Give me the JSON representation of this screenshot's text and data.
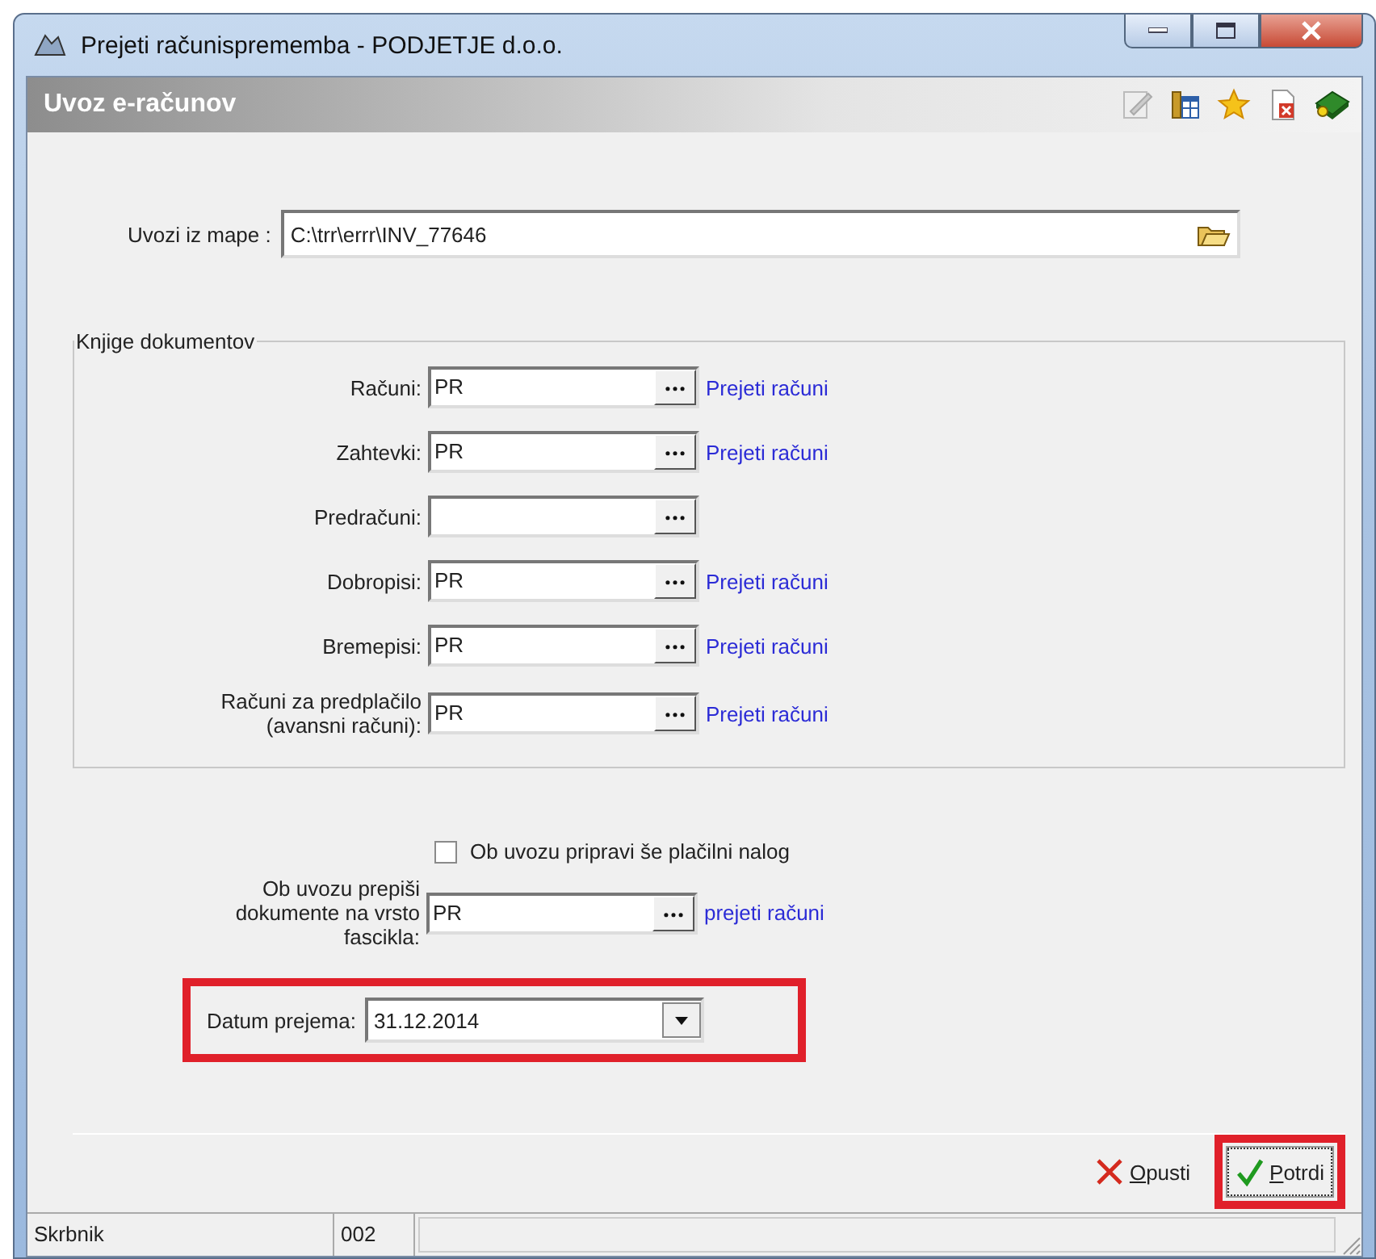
{
  "window": {
    "title": "Prejeti računisprememba - PODJETJE d.o.o."
  },
  "header": {
    "title": "Uvoz e-računov"
  },
  "import_folder": {
    "label": "Uvozi iz mape :",
    "value": "C:\\trr\\errr\\INV_77646"
  },
  "books": {
    "legend": "Knjige dokumentov",
    "rows": [
      {
        "label": "Računi:",
        "value": "PR",
        "description": "Prejeti računi"
      },
      {
        "label": "Zahtevki:",
        "value": "PR",
        "description": "Prejeti računi"
      },
      {
        "label": "Predračuni:"
      },
      {
        "label": "Dobropisi:",
        "value": "PR",
        "description": "Prejeti računi"
      },
      {
        "label": "Bremepisi:",
        "value": "PR",
        "description": "Prejeti računi"
      },
      {
        "label": "Računi za predplačilo\n(avansni računi):",
        "value": "PR",
        "description": "Prejeti računi"
      }
    ]
  },
  "payment_order": {
    "label": "Ob uvozu pripravi še plačilni nalog",
    "checked": false
  },
  "folder_type": {
    "label": "Ob uvozu prepiši\ndokumente na vrsto\nfascikla:",
    "value": "PR",
    "description": "prejeti računi"
  },
  "receipt_date": {
    "label": "Datum prejema:",
    "value": "31.12.2014",
    "highlighted": true
  },
  "buttons": [
    {
      "kind": "cancel",
      "label": "Opusti",
      "highlighted": false
    },
    {
      "kind": "confirm",
      "label": "Potrdi",
      "highlighted": true
    }
  ],
  "status_bar": [
    "Skrbnik",
    "002"
  ]
}
